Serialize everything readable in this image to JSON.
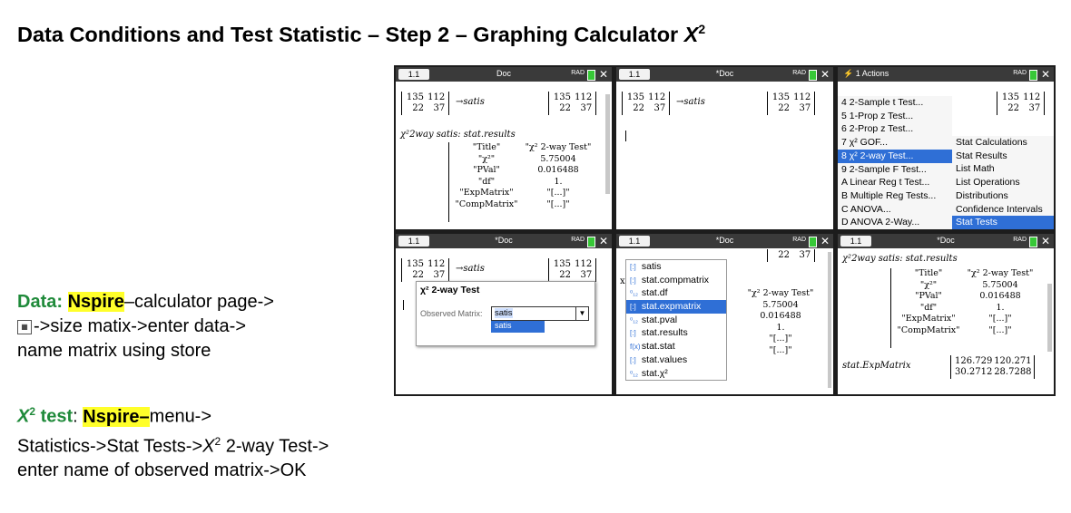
{
  "title": {
    "main": "Data Conditions and Test Statistic – Step 2 – Graphing Calculator ",
    "symbol": "X",
    "sup": "2"
  },
  "data_text": {
    "label": "Data",
    "colon": ": ",
    "nspire": "Nspire",
    "line1_rest": "–calculator page->",
    "line2": "->size matix->enter data->",
    "line3": "name matrix using store"
  },
  "test_text": {
    "symbol": "X",
    "sup": "2",
    "label": " test",
    "colon": ": ",
    "nspire": "Nspire–",
    "line1_rest": "menu->",
    "line2a": "Statistics->Stat Tests->",
    "line2_symbol": "X",
    "line2_sup": "2",
    "line2b": " 2-way Test->",
    "line3": "enter name of observed matrix->OK"
  },
  "calc": {
    "tab_label": "1.1",
    "doc_title": "Doc",
    "doc_title_star": "*Doc",
    "rad_label": "RAD",
    "matrix": [
      [
        "135",
        "112"
      ],
      [
        "22",
        "37"
      ]
    ],
    "store_arrow": "→",
    "store_name": "satis",
    "command": "χ²2way satis: stat.results",
    "result_rows": [
      {
        "key": "\"Title\"",
        "value": "\"χ² 2-way Test\""
      },
      {
        "key": "\"χ²\"",
        "value": "5.75004"
      },
      {
        "key": "\"PVal\"",
        "value": "0.016488"
      },
      {
        "key": "\"df\"",
        "value": "1."
      },
      {
        "key": "\"ExpMatrix\"",
        "value": "\"[...]\""
      },
      {
        "key": "\"CompMatrix\"",
        "value": "\"[...]\""
      }
    ],
    "exp_cmd": "stat.ExpMatrix",
    "exp_matrix": [
      [
        "126.729",
        "120.271"
      ],
      [
        "30.2712",
        "28.7288"
      ]
    ],
    "partial_matrix_row": [
      "22",
      "37"
    ],
    "partial_x2_value": "\"χ² 2-way Test\"",
    "dropdown_x_label": "x",
    "dropdown_quote": "\""
  },
  "actions_menu": {
    "header": "1 Actions",
    "items": [
      "4 2-Sample t Test...",
      "5 1-Prop z Test...",
      "6 2-Prop z Test...",
      "7 χ² GOF...",
      "8 χ² 2-way Test...",
      "9 2-Sample F Test...",
      "A Linear Reg t Test...",
      "B Multiple Reg Tests...",
      "C ANOVA...",
      "D ANOVA 2-Way..."
    ],
    "selected_index": 4,
    "submenu": [
      "Stat Calculations",
      "Stat Results",
      "List Math",
      "List Operations",
      "Distributions",
      "Confidence Intervals",
      "Stat Tests"
    ],
    "submenu_selected_index": 6
  },
  "dialog": {
    "title": "χ² 2-way Test",
    "field_label": "Observed Matrix:",
    "field_value": "satis",
    "option": "satis"
  },
  "var_list": {
    "items": [
      {
        "icon": "[:]",
        "label": "satis"
      },
      {
        "icon": "[:]",
        "label": "stat.compmatrix"
      },
      {
        "icon": "⁰₁₂",
        "label": "stat.df"
      },
      {
        "icon": "[:]",
        "label": "stat.expmatrix"
      },
      {
        "icon": "⁰₁₂",
        "label": "stat.pval"
      },
      {
        "icon": "[:]",
        "label": "stat.results"
      },
      {
        "icon": "f(x)",
        "label": "stat.stat"
      },
      {
        "icon": "[:]",
        "label": "stat.values"
      },
      {
        "icon": "⁰₁₂",
        "label": "stat.χ²"
      }
    ],
    "selected_index": 3
  }
}
